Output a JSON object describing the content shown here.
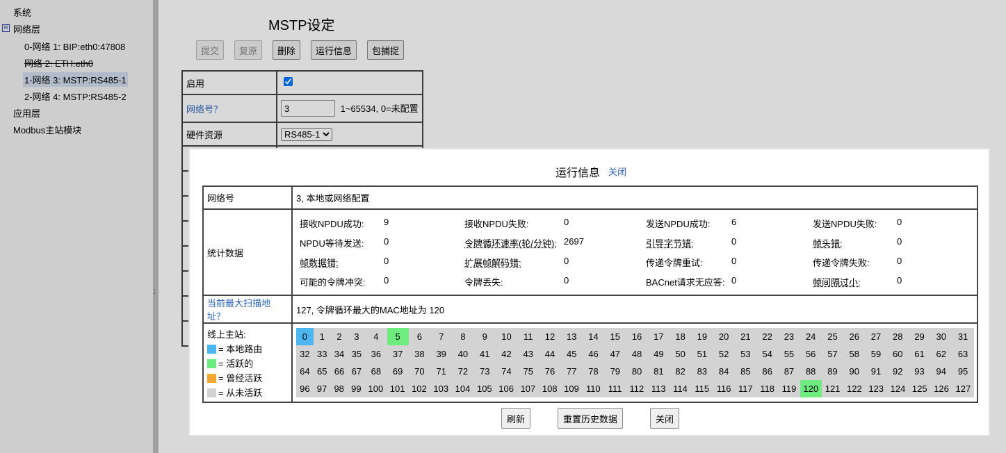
{
  "sidebar": {
    "items": [
      {
        "label": "系统"
      },
      {
        "label": "网络层",
        "toggle": "⊟"
      },
      {
        "label": "0-网络 1: BIP:eth0:47808"
      },
      {
        "label": "网络 2: ETH:eth0"
      },
      {
        "label": "1-网络 3: MSTP:RS485-1"
      },
      {
        "label": "2-网络 4: MSTP:RS485-2"
      },
      {
        "label": "应用层"
      },
      {
        "label": "Modbus主站模块"
      }
    ]
  },
  "page": {
    "title": "MSTP设定",
    "toolbar": [
      "提交",
      "复原",
      "删除",
      "运行信息",
      "包捕捉"
    ],
    "form": {
      "enable_label": "启用",
      "enable_checked": true,
      "network_label": "网络号？",
      "network_value": "3",
      "network_hint": "1~65534, 0=未配置",
      "hw_label": "硬件资源",
      "hw_value": "RS485-1"
    }
  },
  "modal": {
    "title": "运行信息",
    "close_link": "关闭",
    "network_label": "网络号",
    "network_value": "3, 本地或网络配置",
    "stats_label": "统计数据",
    "stats": [
      {
        "label": "接收NPDU成功:",
        "value": "9"
      },
      {
        "label": "接收NPDU失败:",
        "value": "0"
      },
      {
        "label": "发送NPDU成功:",
        "value": "6"
      },
      {
        "label": "发送NPDU失败:",
        "value": "0"
      },
      {
        "label": "NPDU等待发送:",
        "value": "0"
      },
      {
        "label": "令牌循环速率(轮/分钟):",
        "value": "2697"
      },
      {
        "label": "引导字节错:",
        "value": "0"
      },
      {
        "label": "帧头错:",
        "value": "0"
      },
      {
        "label": "帧数据错:",
        "value": "0"
      },
      {
        "label": "扩展帧解码错:",
        "value": "0"
      },
      {
        "label": "传递令牌重试:",
        "value": "0"
      },
      {
        "label": "传递令牌失败:",
        "value": "0"
      },
      {
        "label": "可能的令牌冲突:",
        "value": "0"
      },
      {
        "label": "令牌丢失:",
        "value": "0"
      },
      {
        "label": "BACnet请求无应答:",
        "value": "0"
      },
      {
        "label": "帧间隔过小:",
        "value": "0"
      }
    ],
    "scan_label": "当前最大扫描地址？",
    "scan_value": "127, 令牌循环最大的MAC地址为 120",
    "masters_label": "线上主站:",
    "legend": [
      {
        "color": "#4db6f0",
        "text": "= 本地路由"
      },
      {
        "color": "#6fec7f",
        "text": "= 活跃的"
      },
      {
        "color": "#f2a830",
        "text": "= 曾经活跃"
      },
      {
        "color": "#d3d3d3",
        "text": "= 从未活跃"
      }
    ],
    "node_states": {
      "local": [
        0
      ],
      "active": [
        5,
        120
      ]
    },
    "colors": {
      "local": "#4db6f0",
      "active": "#6fec7f",
      "never": "#d3d3d3"
    },
    "buttons": {
      "refresh": "刷新",
      "reset": "重置历史数据",
      "close": "关闭"
    }
  }
}
